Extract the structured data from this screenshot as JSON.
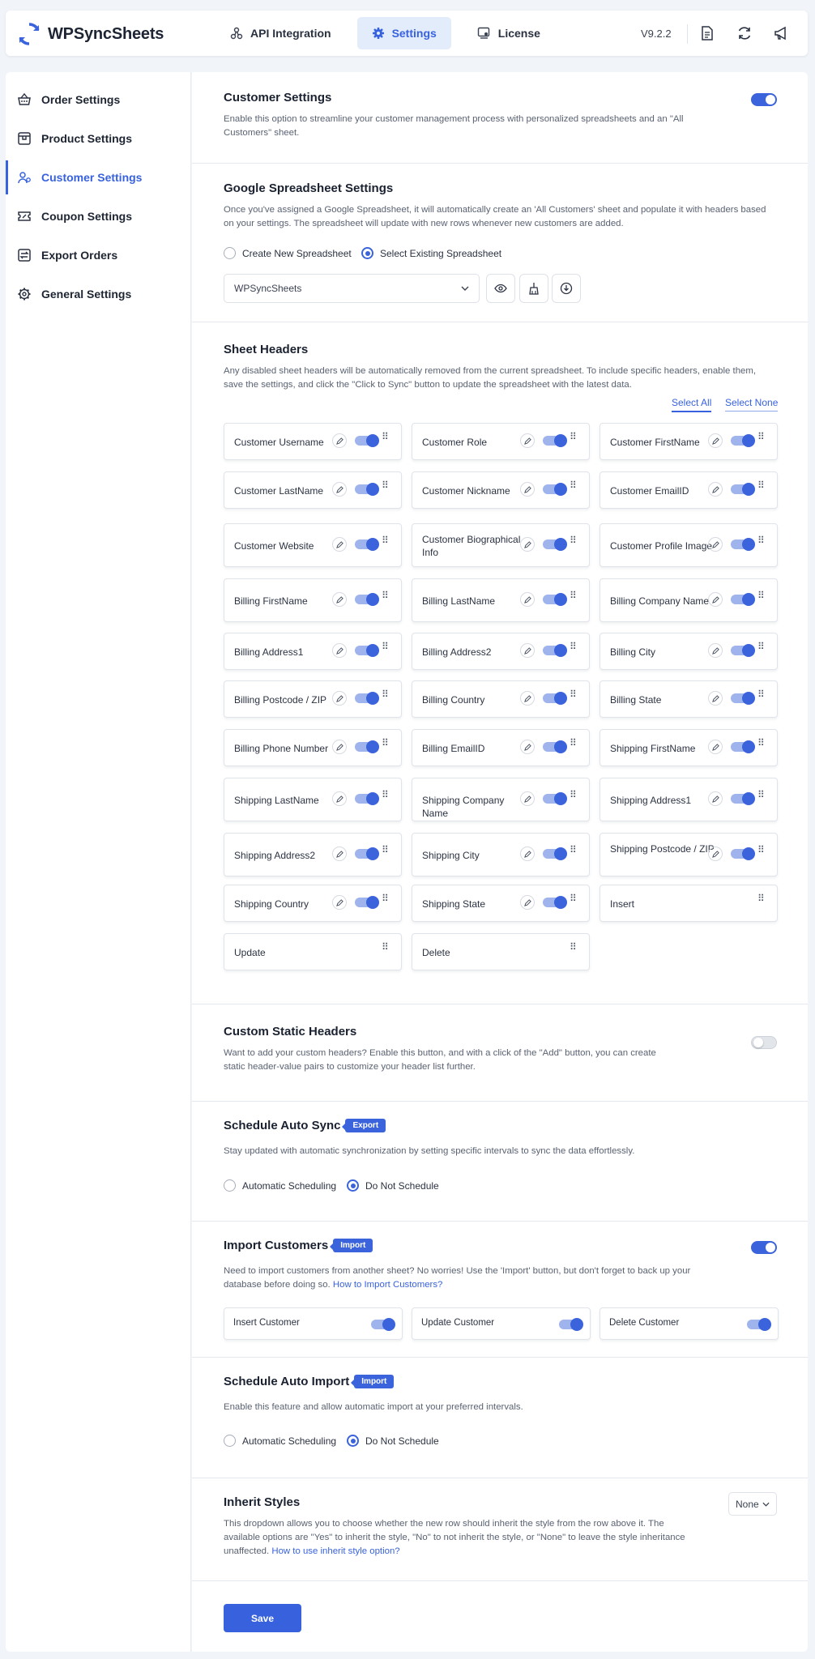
{
  "app": {
    "brand": "WPSyncSheets",
    "version": "V9.2.2"
  },
  "nav": [
    {
      "label": "API Integration",
      "icon": "api-icon"
    },
    {
      "label": "Settings",
      "icon": "gear-icon",
      "active": true
    },
    {
      "label": "License",
      "icon": "license-icon"
    }
  ],
  "sidebar": [
    {
      "label": "Order Settings",
      "icon": "basket-icon"
    },
    {
      "label": "Product Settings",
      "icon": "product-icon"
    },
    {
      "label": "Customer Settings",
      "icon": "customer-icon",
      "active": true
    },
    {
      "label": "Coupon Settings",
      "icon": "coupon-icon"
    },
    {
      "label": "Export Orders",
      "icon": "export-icon"
    },
    {
      "label": "General Settings",
      "icon": "gear-icon"
    }
  ],
  "customer": {
    "title": "Customer Settings",
    "desc": "Enable this option to streamline your customer management process with personalized spreadsheets and an \"All Customers\" sheet.",
    "enabled": true
  },
  "spreadsheet": {
    "title": "Google Spreadsheet Settings",
    "desc": "Once you've assigned a Google Spreadsheet, it will automatically create an 'All Customers' sheet and populate it with headers based on your settings. The spreadsheet will update with new rows whenever new customers are added.",
    "radio_new": "Create New Spreadsheet",
    "radio_existing": "Select Existing Spreadsheet",
    "selected": "WPSyncSheets"
  },
  "headers": {
    "title": "Sheet Headers",
    "desc": "Any disabled sheet headers will be automatically removed from the current spreadsheet. To include specific headers, enable them, save the settings, and click the \"Click to Sync\" button to update the spreadsheet with the latest data.",
    "select_all": "Select All",
    "select_none": "Select None",
    "items": [
      [
        "Customer Username",
        "Customer Role",
        "Customer FirstName"
      ],
      [
        "Customer LastName",
        "Customer Nickname",
        "Customer EmailID"
      ],
      [
        "Customer Website",
        "Customer Biographical Info",
        "Customer Profile Image"
      ],
      [
        "Billing FirstName",
        "Billing LastName",
        "Billing Company Name"
      ],
      [
        "Billing Address1",
        "Billing Address2",
        "Billing City"
      ],
      [
        "Billing Postcode / ZIP",
        "Billing Country",
        "Billing State"
      ],
      [
        "Billing Phone Number",
        "Billing EmailID",
        "Shipping FirstName"
      ],
      [
        "Shipping LastName",
        "Shipping Company Name",
        "Shipping Address1"
      ],
      [
        "Shipping Address2",
        "Shipping City",
        "Shipping Postcode / ZIP"
      ],
      [
        "Shipping Country",
        "Shipping State",
        "Insert"
      ],
      [
        "Update",
        "Delete"
      ]
    ]
  },
  "static_headers": {
    "title": "Custom Static Headers",
    "desc": "Want to add your custom headers? Enable this button, and with a click of the \"Add\" button, you can create static header-value pairs to customize your header list further.",
    "enabled": false
  },
  "auto_sync": {
    "title": "Schedule Auto Sync",
    "tag": "Export",
    "desc": "Stay updated with automatic synchronization by setting specific intervals to sync the data effortlessly.",
    "radio_auto": "Automatic Scheduling",
    "radio_none": "Do Not Schedule"
  },
  "import": {
    "title": "Import Customers",
    "tag": "Import",
    "desc": "Need to import customers from another sheet? No worries! Use the 'Import' button, but don't forget to back up your database before doing so.",
    "link": "How to Import Customers?",
    "options": [
      "Insert Customer",
      "Update Customer",
      "Delete Customer"
    ],
    "enabled": true
  },
  "auto_import": {
    "title": "Schedule Auto Import",
    "tag": "Import",
    "desc": "Enable this feature and allow automatic import at your preferred intervals.",
    "radio_auto": "Automatic Scheduling",
    "radio_none": "Do Not Schedule"
  },
  "inherit": {
    "title": "Inherit Styles",
    "desc": "This dropdown allows you to choose whether the new row should inherit the style from the row above it. The available options are \"Yes\" to inherit the style, \"No\" to not inherit the style, or \"None\" to leave the style inheritance unaffected.",
    "link": "How to use inherit style option?",
    "selected": "None"
  },
  "save_label": "Save",
  "colors": {
    "accent": "#3b63dc",
    "active_nav_bg": "#e3ecfb"
  }
}
